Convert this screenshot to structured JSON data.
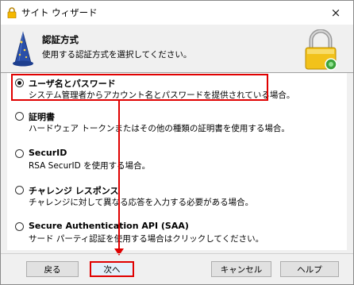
{
  "window": {
    "title": "サイト ウィザード",
    "close_glyph": "×"
  },
  "header": {
    "title": "認証方式",
    "description": "使用する認証方式を選択してください。",
    "left_icon": "wizard-hat-icon",
    "right_icon": "lock-icon"
  },
  "options": [
    {
      "label": "ユーザ名とパスワード",
      "description": "システム管理者からアカウント名とパスワードを提供されている場合。",
      "selected": true
    },
    {
      "label": "証明書",
      "description": "ハードウェア トークンまたはその他の種類の証明書を使用する場合。",
      "selected": false
    },
    {
      "label": "SecurID",
      "description": "RSA SecurID を使用する場合。",
      "selected": false
    },
    {
      "label": "チャレンジ レスポンス",
      "description": "チャレンジに対して異なる応答を入力する必要がある場合。",
      "selected": false
    },
    {
      "label": "Secure Authentication API (SAA)",
      "description": "サード パーティ認証を使用する場合はクリックしてください。",
      "selected": false
    }
  ],
  "buttons": {
    "back": "戻る",
    "next": "次へ",
    "cancel": "キャンセル",
    "help": "ヘルプ"
  },
  "colors": {
    "highlight": "#e00000"
  }
}
